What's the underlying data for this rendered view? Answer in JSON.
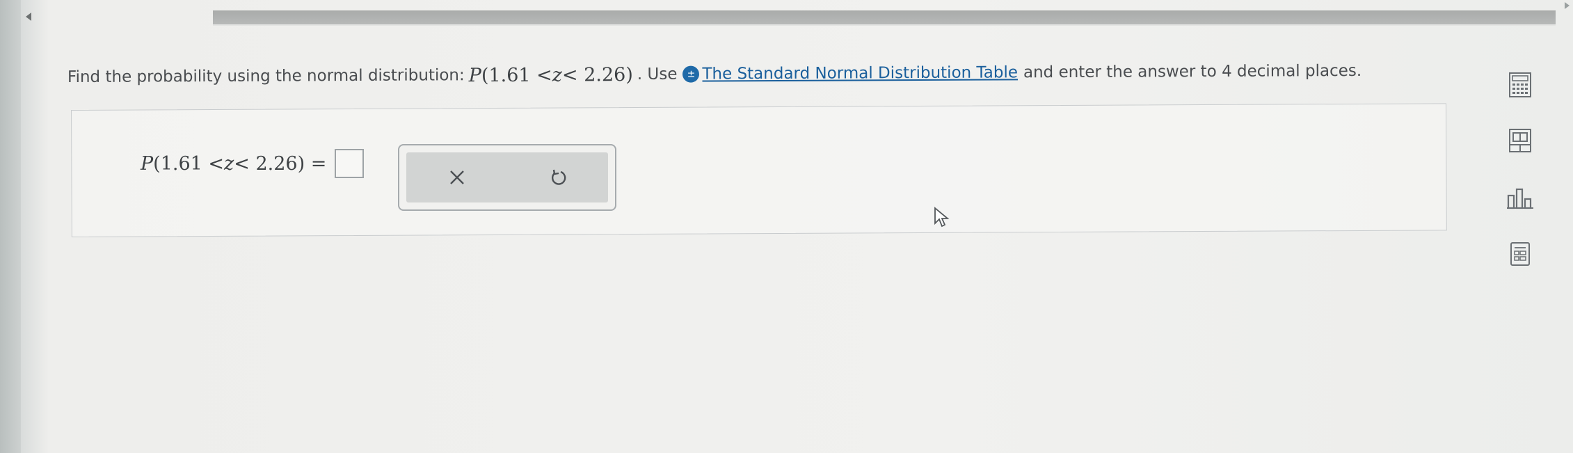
{
  "question": {
    "prefix": "Find the probability using the normal distribution: ",
    "expr_p": "P",
    "expr_open": "(1.61 <",
    "expr_z": "z",
    "expr_close": "< 2.26)",
    "after_expr": ". Use",
    "link_text": "The Standard Normal Distribution Table",
    "suffix": " and enter the answer to 4 decimal places."
  },
  "answer": {
    "p": "P",
    "open": "(1.61 <",
    "z": "z",
    "close": "< 2.26) =",
    "value": ""
  },
  "buttons": {
    "clear_icon": "x-icon",
    "undo_icon": "undo-icon"
  },
  "side_tools": [
    "calculator-icon",
    "table-icon",
    "bar-chart-icon",
    "formula-sheet-icon"
  ],
  "colors": {
    "link": "#1a5f9c",
    "info_icon": "#1f6aa8",
    "text": "#4a4d50"
  }
}
